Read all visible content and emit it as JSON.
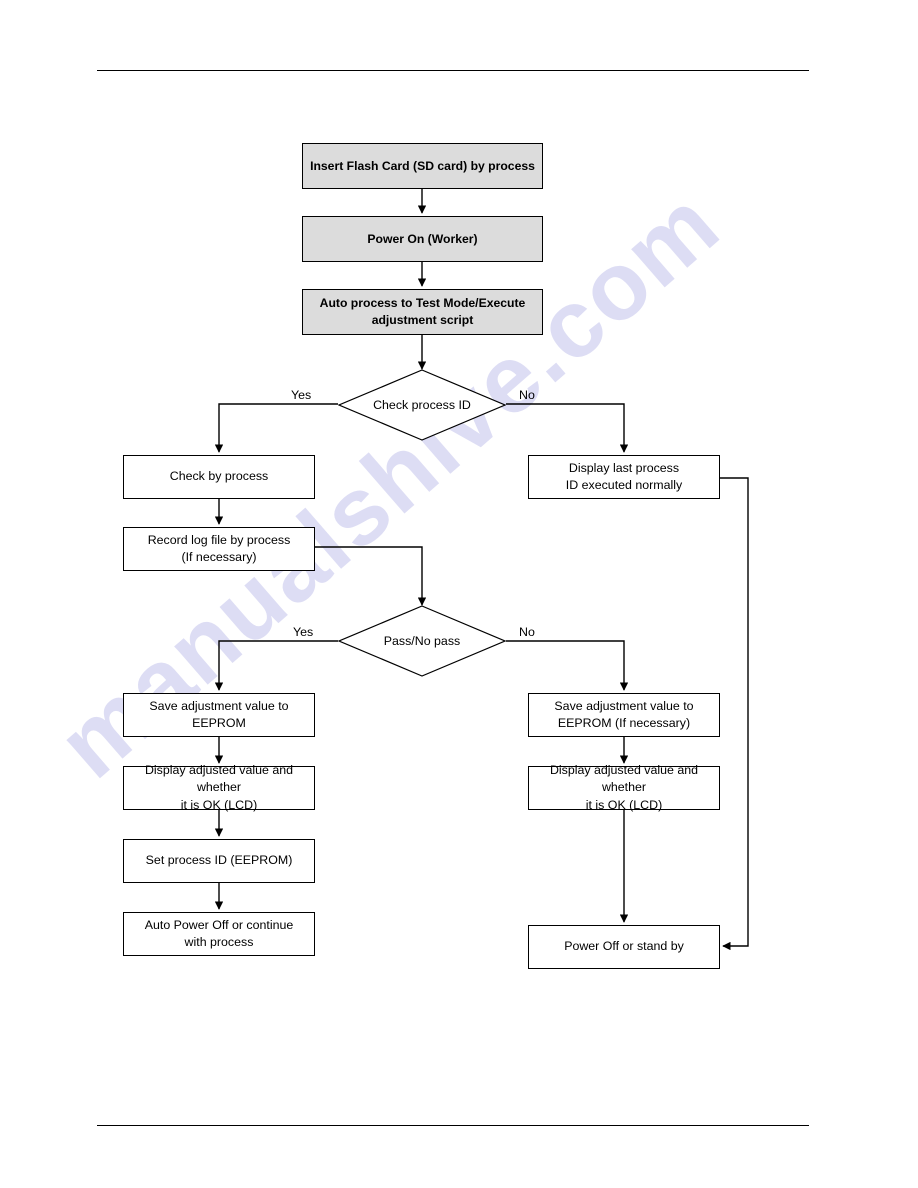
{
  "document": {
    "watermark": "manualshive.com",
    "watermark_color": "#c9c9ee",
    "rule_color": "#000000",
    "shaded_node_fill": "#dcdcdc",
    "node_border_color": "#000000",
    "page_background": "#ffffff"
  },
  "flowchart": {
    "type": "flowchart",
    "title": "",
    "nodes": [
      {
        "id": "n1",
        "label": "Insert Flash Card (SD card) by process",
        "shape": "process",
        "style": "shaded"
      },
      {
        "id": "n2",
        "label": "Power On (Worker)",
        "shape": "process",
        "style": "shaded"
      },
      {
        "id": "n3",
        "label": "Auto process to Test Mode/Execute adjustment script",
        "shape": "process",
        "style": "shaded"
      },
      {
        "id": "d1",
        "label": "Check process ID",
        "shape": "decision",
        "style": "plain"
      },
      {
        "id": "n4",
        "label": "Check by process",
        "shape": "process",
        "style": "plain"
      },
      {
        "id": "n5",
        "label": "Record log file by process (If necessary)",
        "shape": "process",
        "style": "plain"
      },
      {
        "id": "n6",
        "label": "Display last process ID executed normally",
        "shape": "process",
        "style": "plain"
      },
      {
        "id": "d2",
        "label": "Pass/No pass",
        "shape": "decision",
        "style": "plain"
      },
      {
        "id": "n7",
        "label": "Save adjustment value to EEPROM",
        "shape": "process",
        "style": "plain"
      },
      {
        "id": "n8",
        "label": "Display adjusted value and whether it is OK (LCD)",
        "shape": "process",
        "style": "plain"
      },
      {
        "id": "n9",
        "label": "Set process ID (EEPROM)",
        "shape": "process",
        "style": "plain"
      },
      {
        "id": "n10",
        "label": "Auto Power Off or continue with process",
        "shape": "process",
        "style": "plain"
      },
      {
        "id": "n11",
        "label": "Save adjustment value to EEPROM (If necessary)",
        "shape": "process",
        "style": "plain"
      },
      {
        "id": "n12",
        "label": "Display adjusted value and whether it is OK (LCD)",
        "shape": "process",
        "style": "plain"
      },
      {
        "id": "n13",
        "label": "Power Off or stand by",
        "shape": "process",
        "style": "plain"
      }
    ],
    "node_lines": {
      "n1": [
        "Insert Flash Card (SD card) by process"
      ],
      "n2": [
        "Power On (Worker)"
      ],
      "n3": [
        "Auto process to Test Mode/Execute",
        "adjustment script"
      ],
      "n4": [
        "Check by process"
      ],
      "n5": [
        "Record log file by process",
        "(If necessary)"
      ],
      "n6": [
        "Display last process",
        "ID executed normally"
      ],
      "n7": [
        "Save adjustment value to EEPROM"
      ],
      "n8": [
        "Display adjusted value and whether",
        "it is OK (LCD)"
      ],
      "n9": [
        "Set process ID (EEPROM)"
      ],
      "n10": [
        "Auto Power Off or continue",
        "with process"
      ],
      "n11": [
        "Save adjustment value to",
        "EEPROM (If necessary)"
      ],
      "n12": [
        "Display adjusted value and whether",
        "it is OK (LCD)"
      ],
      "n13": [
        "Power Off or stand by"
      ]
    },
    "branch_labels": {
      "d1_yes": "Yes",
      "d1_no": "No",
      "d2_yes": "Yes",
      "d2_no": "No"
    },
    "edges": [
      {
        "from": "n1",
        "to": "n2",
        "label": ""
      },
      {
        "from": "n2",
        "to": "n3",
        "label": ""
      },
      {
        "from": "n3",
        "to": "d1",
        "label": ""
      },
      {
        "from": "d1",
        "to": "n4",
        "label": "Yes"
      },
      {
        "from": "d1",
        "to": "n6",
        "label": "No"
      },
      {
        "from": "n4",
        "to": "n5",
        "label": ""
      },
      {
        "from": "n5",
        "to": "d2",
        "label": ""
      },
      {
        "from": "d2",
        "to": "n7",
        "label": "Yes"
      },
      {
        "from": "d2",
        "to": "n11",
        "label": "No"
      },
      {
        "from": "n7",
        "to": "n8",
        "label": ""
      },
      {
        "from": "n8",
        "to": "n9",
        "label": ""
      },
      {
        "from": "n9",
        "to": "n10",
        "label": ""
      },
      {
        "from": "n11",
        "to": "n12",
        "label": ""
      },
      {
        "from": "n12",
        "to": "n13",
        "label": ""
      },
      {
        "from": "n6",
        "to": "n13",
        "label": ""
      }
    ]
  }
}
